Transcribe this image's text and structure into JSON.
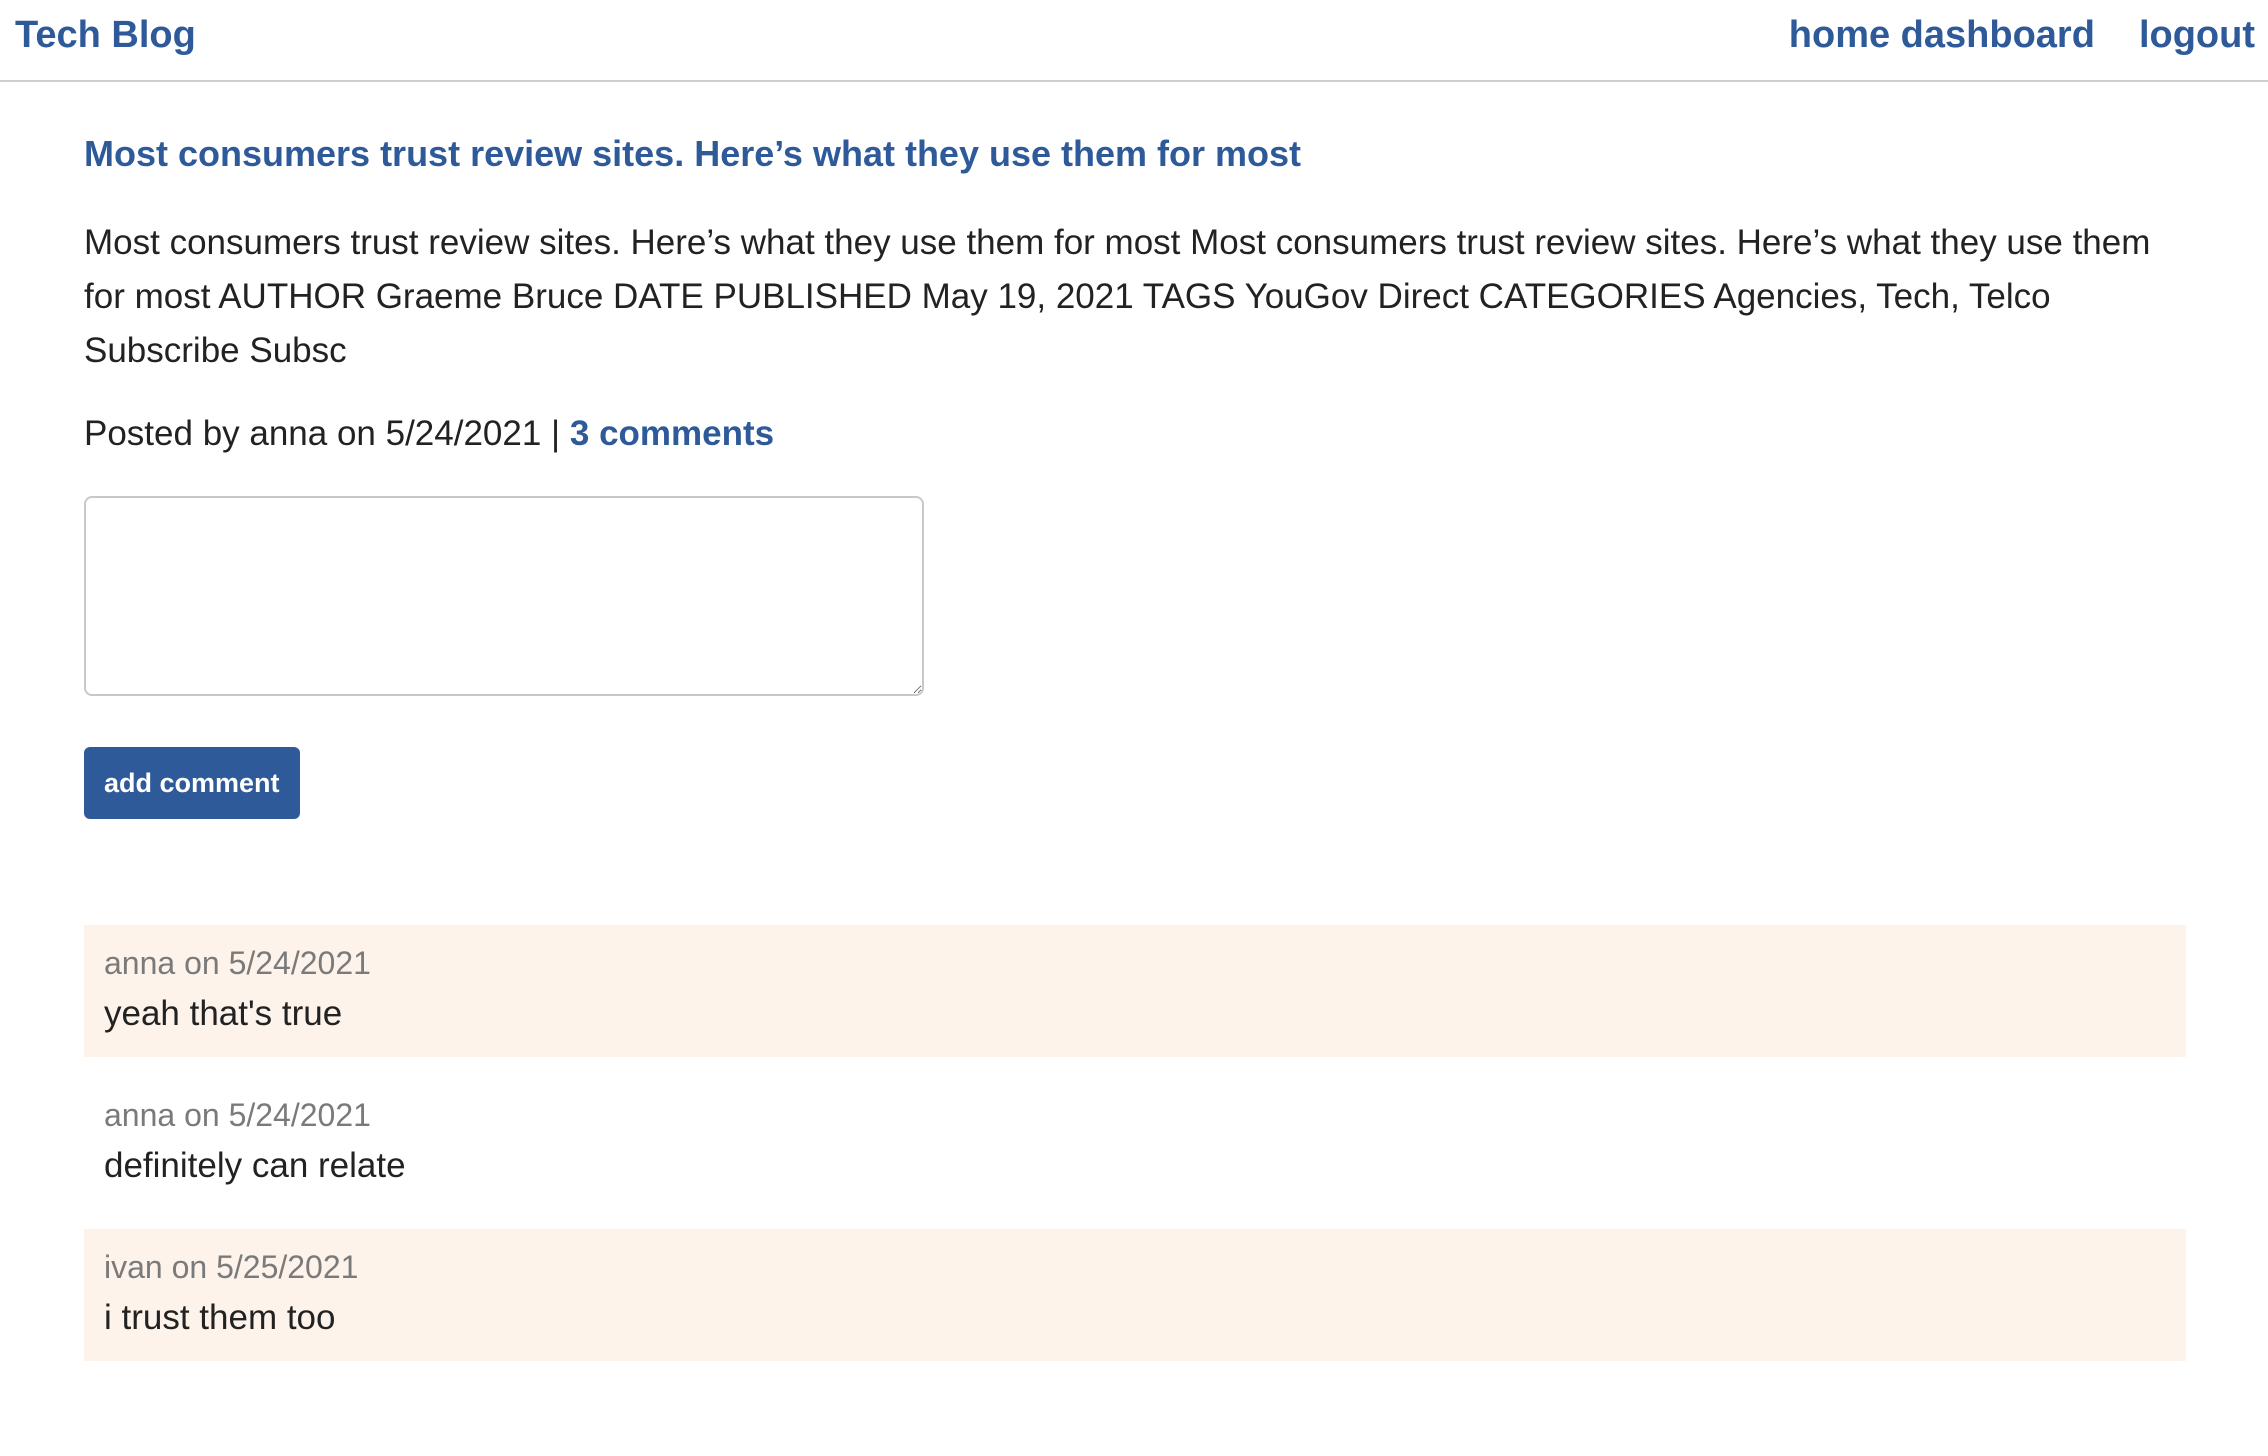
{
  "header": {
    "brand": "Tech Blog",
    "nav": {
      "home_dashboard": "home dashboard",
      "logout": "logout"
    }
  },
  "post": {
    "title": "Most consumers trust review sites. Here’s what they use them for most",
    "body": "Most consumers trust review sites. Here’s what they use them for most Most consumers trust review sites. Here’s what they use them for most AUTHOR Graeme Bruce DATE PUBLISHED May 19, 2021 TAGS YouGov Direct CATEGORIES Agencies, Tech, Telco Subscribe Subsc",
    "meta_prefix": "Posted by anna on 5/24/2021 | ",
    "comments_link": "3 comments"
  },
  "comment_form": {
    "textarea_value": "",
    "submit_label": "add comment"
  },
  "comments": [
    {
      "meta": "anna on 5/24/2021",
      "text": "yeah that's true"
    },
    {
      "meta": "anna on 5/24/2021",
      "text": "definitely can relate"
    },
    {
      "meta": "ivan on 5/25/2021",
      "text": "i trust them too"
    }
  ],
  "colors": {
    "link": "#2e5a9a",
    "shaded_comment_bg": "#fdf3ea",
    "meta_gray": "#7a7a7a"
  }
}
